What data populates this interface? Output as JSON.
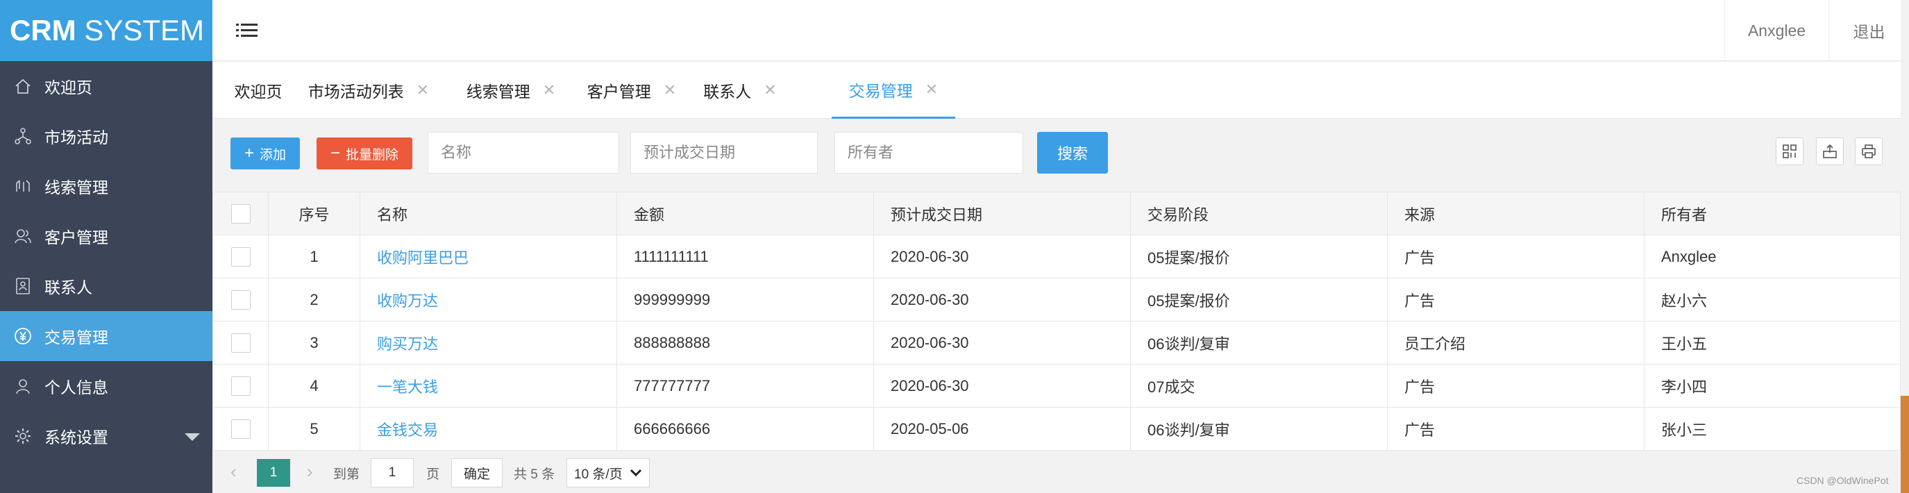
{
  "app": {
    "logo_bold": "CRM",
    "logo_rest": " SYSTEM"
  },
  "sidebar": {
    "items": [
      {
        "label": "欢迎页",
        "icon": "home-icon"
      },
      {
        "label": "市场活动",
        "icon": "network-icon"
      },
      {
        "label": "线索管理",
        "icon": "clue-icon"
      },
      {
        "label": "客户管理",
        "icon": "customer-icon"
      },
      {
        "label": "联系人",
        "icon": "contact-card-icon"
      },
      {
        "label": "交易管理",
        "icon": "yen-icon",
        "active": true
      },
      {
        "label": "个人信息",
        "icon": "user-icon"
      },
      {
        "label": "系统设置",
        "icon": "gear-icon"
      }
    ]
  },
  "header": {
    "user": "Anxglee",
    "logout": "退出"
  },
  "tabs": [
    {
      "label": "欢迎页",
      "closable": false
    },
    {
      "label": "市场活动列表",
      "closable": true
    },
    {
      "label": "线索管理",
      "closable": true
    },
    {
      "label": "客户管理",
      "closable": true
    },
    {
      "label": "联系人",
      "closable": true
    },
    {
      "label": "交易管理",
      "closable": true,
      "active": true
    }
  ],
  "toolbar": {
    "add_label": "添加",
    "batch_delete_label": "批量删除",
    "name_placeholder": "名称",
    "date_placeholder": "预计成交日期",
    "owner_placeholder": "所有者",
    "search_label": "搜索"
  },
  "table": {
    "headers": [
      "序号",
      "名称",
      "金额",
      "预计成交日期",
      "交易阶段",
      "来源",
      "所有者"
    ],
    "rows": [
      {
        "idx": "1",
        "name": "收购阿里巴巴",
        "amount": "1111111111",
        "date": "2020-06-30",
        "stage": "05提案/报价",
        "source": "广告",
        "owner": "Anxglee"
      },
      {
        "idx": "2",
        "name": "收购万达",
        "amount": "999999999",
        "date": "2020-06-30",
        "stage": "05提案/报价",
        "source": "广告",
        "owner": "赵小六"
      },
      {
        "idx": "3",
        "name": "购买万达",
        "amount": "888888888",
        "date": "2020-06-30",
        "stage": "06谈判/复审",
        "source": "员工介绍",
        "owner": "王小五"
      },
      {
        "idx": "4",
        "name": "一笔大钱",
        "amount": "777777777",
        "date": "2020-06-30",
        "stage": "07成交",
        "source": "广告",
        "owner": "李小四"
      },
      {
        "idx": "5",
        "name": "金钱交易",
        "amount": "666666666",
        "date": "2020-05-06",
        "stage": "06谈判/复审",
        "source": "广告",
        "owner": "张小三"
      }
    ]
  },
  "pager": {
    "current": "1",
    "goto_label": "到第",
    "page_value": "1",
    "page_label": "页",
    "confirm_label": "确定",
    "total_label": "共 5 条",
    "page_size": "10 条/页"
  },
  "watermark": "CSDN @OldWinePot",
  "colors": {
    "sidebar_bg": "#3b4557",
    "accent": "#3c9ee5",
    "danger": "#ec5a3b",
    "pager_active": "#2f9688"
  }
}
